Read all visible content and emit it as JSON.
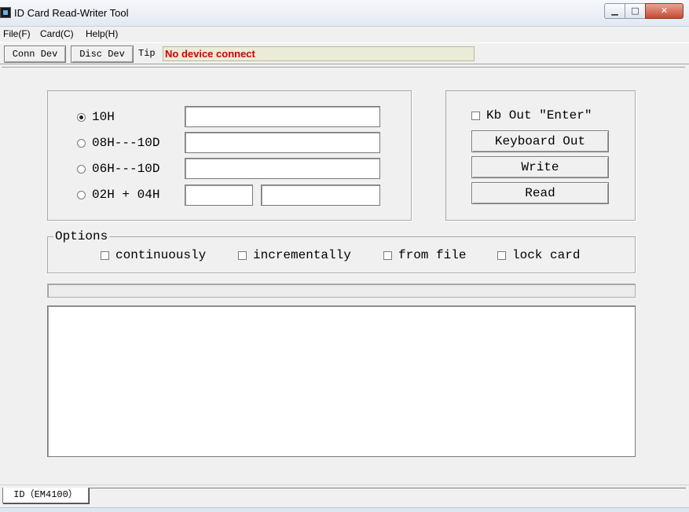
{
  "window": {
    "title": "ID Card Read-Writer Tool",
    "min_glyph": "▁",
    "max_glyph": "□",
    "close_glyph": "✕"
  },
  "menu": {
    "items": [
      "File(F)",
      "Card(C)",
      "Help(H)"
    ]
  },
  "toolbar": {
    "conn_label": "Conn Dev",
    "disc_label": "Disc Dev",
    "tip_label": "Tip",
    "tip_text": "No device connect"
  },
  "format": {
    "options": [
      "10H",
      "08H---10D",
      "06H---10D",
      "02H + 04H"
    ],
    "selected": "10H",
    "values": {
      "hex10": "",
      "hex08": "",
      "hex06": "",
      "hex02": "",
      "hex04": ""
    }
  },
  "actions": {
    "kb_enter_label": "Kb Out \"Enter\"",
    "keyboard_out_label": "Keyboard Out",
    "write_label": "Write",
    "read_label": "Read"
  },
  "options": {
    "legend": "Options",
    "items": [
      "continuously",
      "incrementally",
      "from file",
      "lock card"
    ]
  },
  "tabs": [
    "ID（EM4100）"
  ],
  "colors": {
    "tip_text": "#d00000",
    "tip_bg": "#ecebd8"
  }
}
